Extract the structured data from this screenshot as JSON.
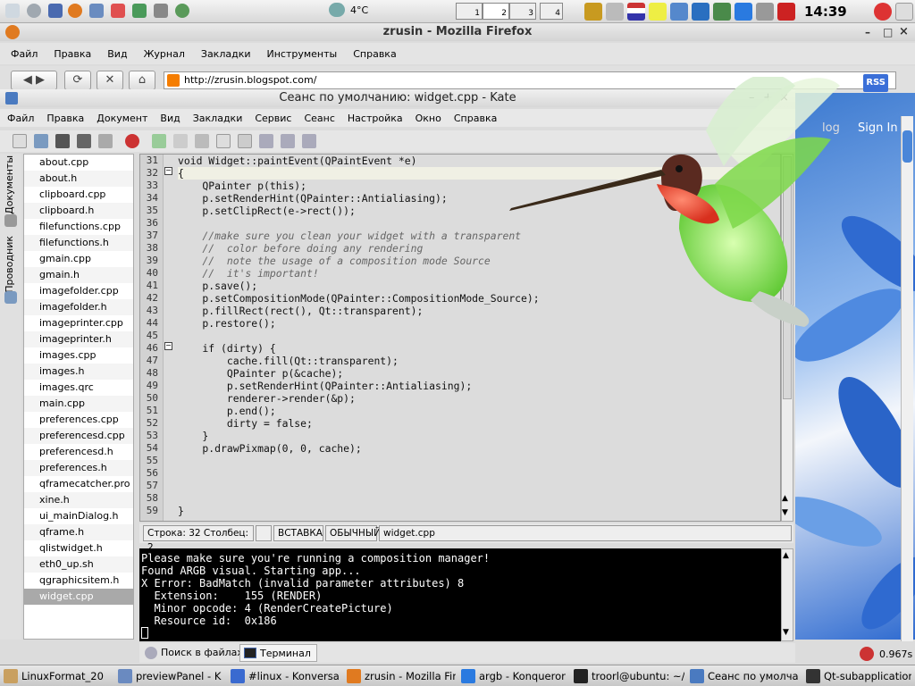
{
  "top_panel": {
    "weather_temp": "4°C",
    "pager": [
      "1",
      "2",
      "3",
      "4"
    ],
    "clock": "14:39"
  },
  "firefox": {
    "title": "zrusin - Mozilla Firefox",
    "menu": [
      "Файл",
      "Правка",
      "Вид",
      "Журнал",
      "Закладки",
      "Инструменты",
      "Справка"
    ],
    "url": "http://zrusin.blogspot.com/",
    "rss_label": "RSS",
    "page_link": "Sign In",
    "page_link_partial": "log"
  },
  "kate": {
    "title": "Сеанс по умолчанию: widget.cpp - Kate",
    "menu": [
      "Файл",
      "Правка",
      "Документ",
      "Вид",
      "Закладки",
      "Сервис",
      "Сеанс",
      "Настройка",
      "Окно",
      "Справка"
    ],
    "side_tabs": [
      "Документы",
      "Проводник"
    ],
    "files": [
      "about.cpp",
      "about.h",
      "clipboard.cpp",
      "clipboard.h",
      "filefunctions.cpp",
      "filefunctions.h",
      "gmain.cpp",
      "gmain.h",
      "imagefolder.cpp",
      "imagefolder.h",
      "imageprinter.cpp",
      "imageprinter.h",
      "images.cpp",
      "images.h",
      "images.qrc",
      "main.cpp",
      "preferences.cpp",
      "preferencesd.cpp",
      "preferencesd.h",
      "preferences.h",
      "qframecatcher.pro",
      "xine.h",
      "ui_mainDialog.h",
      "qframe.h",
      "qlistwidget.h",
      "eth0_up.sh",
      "qgraphicsitem.h",
      "widget.cpp"
    ],
    "selected_file": "widget.cpp",
    "line_numbers": [
      "31",
      "32",
      "33",
      "34",
      "35",
      "36",
      "37",
      "38",
      "39",
      "40",
      "41",
      "42",
      "43",
      "44",
      "45",
      "46",
      "47",
      "48",
      "49",
      "50",
      "51",
      "52",
      "53",
      "54",
      "55",
      "56",
      "57",
      "58",
      "59"
    ],
    "code_lines": [
      "void Widget::paintEvent(QPaintEvent *e)",
      "{",
      "    QPainter p(this);",
      "    p.setRenderHint(QPainter::Antialiasing);",
      "    p.setClipRect(e->rect());",
      "",
      "    //make sure you clean your widget with a transparent",
      "    //  color before doing any rendering",
      "    //  note the usage of a composition mode Source",
      "    //  it's important!",
      "    p.save();",
      "    p.setCompositionMode(QPainter::CompositionMode_Source);",
      "    p.fillRect(rect(), Qt::transparent);",
      "    p.restore();",
      "",
      "    if (dirty) {",
      "        cache.fill(Qt::transparent);",
      "        QPainter p(&cache);",
      "        p.setRenderHint(QPainter::Antialiasing);",
      "        renderer->render(&p);",
      "        p.end();",
      "        dirty = false;",
      "    }",
      "    p.drawPixmap(0, 0, cache);",
      "",
      "",
      "",
      "",
      "}"
    ],
    "status": {
      "position": "Строка: 32 Столбец: 2",
      "mode": "ВСТАВКА",
      "type": "ОБЫЧНЫЙ",
      "filename": "widget.cpp"
    },
    "terminal_lines": [
      "Please make sure you're running a composition manager!",
      "Found ARGB visual. Starting app...",
      "X Error: BadMatch (invalid parameter attributes) 8",
      "  Extension:    155 (RENDER)",
      "  Minor opcode: 4 (RenderCreatePicture)",
      "  Resource id:  0x186"
    ],
    "bottom_tabs": [
      "Поиск в файлах",
      "Терминал"
    ]
  },
  "load_indicator": "0.967s",
  "taskbar": [
    "LinuxFormat_20",
    "previewPanel - K",
    "#linux - Konversa",
    "zrusin - Mozilla Fir",
    "argb - Konqueror",
    "troorl@ubuntu: ~/",
    "Сеанс по умолча",
    "Qt-subapplication"
  ],
  "colors": {
    "terminal_bg": "#000000",
    "selection": "#a9a9a9",
    "bird_body": "#5ec832",
    "bird_throat": "#e03c28",
    "wallpaper_petal": "#3d7ad0"
  }
}
